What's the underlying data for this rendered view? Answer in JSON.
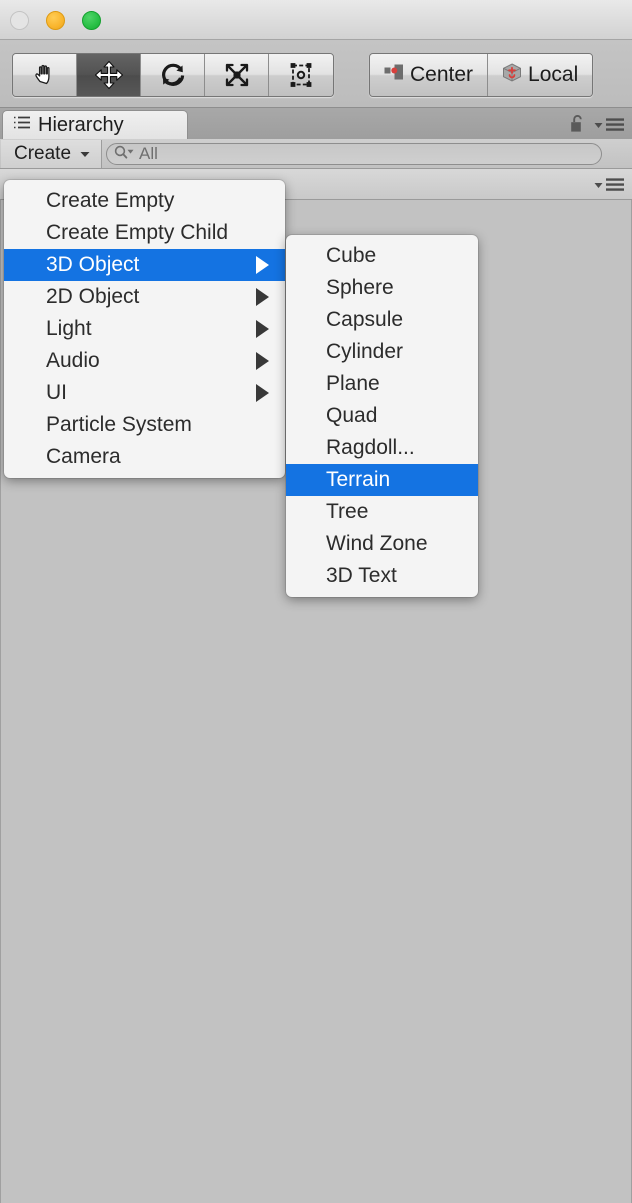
{
  "window": {
    "traffic_lights": [
      {
        "name": "close",
        "color": "#e4e4e4",
        "enabled": false
      },
      {
        "name": "minimize",
        "color": "#f9b52d",
        "enabled": true
      },
      {
        "name": "maximize",
        "color": "#28bf45",
        "enabled": true
      }
    ]
  },
  "toolbar": {
    "transform_tools": [
      {
        "icon": "hand-icon",
        "label": "Hand Tool",
        "active": false
      },
      {
        "icon": "move-icon",
        "label": "Move Tool",
        "active": true
      },
      {
        "icon": "rotate-icon",
        "label": "Rotate Tool",
        "active": false
      },
      {
        "icon": "scale-icon",
        "label": "Scale Tool",
        "active": false
      },
      {
        "icon": "rect-icon",
        "label": "Rect Transform",
        "active": false
      }
    ],
    "pivot_tools": [
      {
        "icon": "center-icon",
        "label": "Center"
      },
      {
        "icon": "local-icon",
        "label": "Local"
      }
    ]
  },
  "hierarchy": {
    "tab_label": "Hierarchy",
    "tab_icon": "hierarchy-list-icon",
    "lock_icon": "padlock-open-icon",
    "panel_menu_icon": "panel-menu-icon",
    "create_button": {
      "label": "Create",
      "dropdown_icon": "chevron-down-icon"
    },
    "search": {
      "icon": "search-icon",
      "value": "All",
      "placeholder": "All"
    }
  },
  "secondary_panel": {
    "panel_menu_icon": "panel-menu-icon"
  },
  "create_menu": {
    "name": "create-menu",
    "items": [
      {
        "label": "Create Empty",
        "submenu": false,
        "selected": false
      },
      {
        "label": "Create Empty Child",
        "submenu": false,
        "selected": false
      },
      {
        "label": "3D Object",
        "submenu": true,
        "selected": true
      },
      {
        "label": "2D Object",
        "submenu": true,
        "selected": false
      },
      {
        "label": "Light",
        "submenu": true,
        "selected": false
      },
      {
        "label": "Audio",
        "submenu": true,
        "selected": false
      },
      {
        "label": "UI",
        "submenu": true,
        "selected": false
      },
      {
        "label": "Particle System",
        "submenu": false,
        "selected": false
      },
      {
        "label": "Camera",
        "submenu": false,
        "selected": false
      }
    ]
  },
  "object_submenu": {
    "name": "3d-object-submenu",
    "items": [
      {
        "label": "Cube",
        "selected": false
      },
      {
        "label": "Sphere",
        "selected": false
      },
      {
        "label": "Capsule",
        "selected": false
      },
      {
        "label": "Cylinder",
        "selected": false
      },
      {
        "label": "Plane",
        "selected": false
      },
      {
        "label": "Quad",
        "selected": false
      },
      {
        "label": "Ragdoll...",
        "selected": false
      },
      {
        "label": "Terrain",
        "selected": true
      },
      {
        "label": "Tree",
        "selected": false
      },
      {
        "label": "Wind Zone",
        "selected": false
      },
      {
        "label": "3D Text",
        "selected": false
      }
    ]
  },
  "colors": {
    "menu_highlight": "#1473e2",
    "menu_background": "#f4f4f4",
    "panel_background": "#c2c2c2",
    "toolbar_background": "#c0c0c0",
    "accent_red": "#d8403c"
  }
}
